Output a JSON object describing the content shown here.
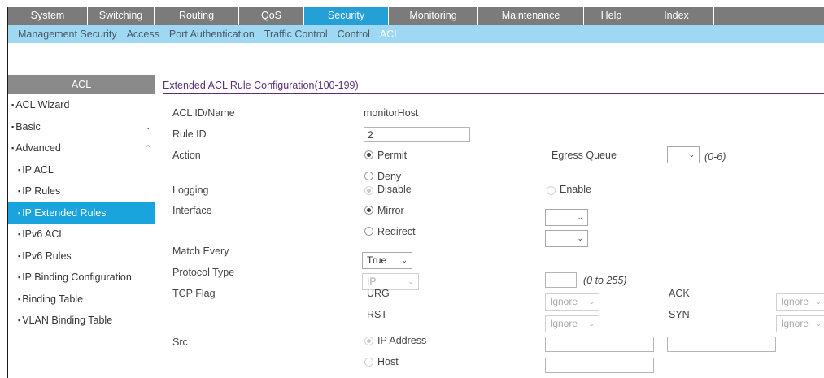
{
  "topnav": [
    {
      "label": "System",
      "w": 98
    },
    {
      "label": "Switching",
      "w": 82
    },
    {
      "label": "Routing",
      "w": 104
    },
    {
      "label": "QoS",
      "w": 80
    },
    {
      "label": "Security",
      "w": 104,
      "active": true
    },
    {
      "label": "Monitoring",
      "w": 110
    },
    {
      "label": "Maintenance",
      "w": 130
    },
    {
      "label": "Help",
      "w": 68
    },
    {
      "label": "Index",
      "w": 92
    }
  ],
  "subnav": [
    {
      "label": "Management Security"
    },
    {
      "label": "Access"
    },
    {
      "label": "Port Authentication"
    },
    {
      "label": "Traffic Control"
    },
    {
      "label": "Control"
    },
    {
      "label": "ACL",
      "active": true
    }
  ],
  "sidebar": {
    "title": "ACL",
    "items": [
      {
        "label": "ACL Wizard",
        "level": 1
      },
      {
        "label": "Basic",
        "level": 1,
        "chevron": "⌄"
      },
      {
        "label": "Advanced",
        "level": 1,
        "chevron": "⌃"
      },
      {
        "label": "IP ACL",
        "level": 2
      },
      {
        "label": "IP Rules",
        "level": 2
      },
      {
        "label": "IP Extended Rules",
        "level": 2,
        "active": true
      },
      {
        "label": "IPv6 ACL",
        "level": 2
      },
      {
        "label": "IPv6 Rules",
        "level": 2
      },
      {
        "label": "IP Binding Configuration",
        "level": 2
      },
      {
        "label": "Binding Table",
        "level": 2
      },
      {
        "label": "VLAN Binding Table",
        "level": 2
      }
    ]
  },
  "form": {
    "title": "Extended ACL Rule Configuration(100-199)",
    "acl_id_label": "ACL ID/Name",
    "acl_id_value": "monitorHost",
    "rule_id_label": "Rule ID",
    "rule_id_value": "2",
    "action_label": "Action",
    "permit_label": "Permit",
    "deny_label": "Deny",
    "egress_queue_label": "Egress Queue",
    "egress_queue_range": "(0-6)",
    "logging_label": "Logging",
    "disable_label": "Disable",
    "enable_label": "Enable",
    "interface_label": "Interface",
    "mirror_label": "Mirror",
    "redirect_label": "Redirect",
    "match_every_label": "Match Every",
    "match_every_value": "True",
    "protocol_type_label": "Protocol Type",
    "protocol_type_value": "IP",
    "protocol_range": "(0 to 255)",
    "tcp_flag_label": "TCP Flag",
    "urg_label": "URG",
    "rst_label": "RST",
    "ack_label": "ACK",
    "syn_label": "SYN",
    "ignore_value": "Ignore",
    "src_label": "Src",
    "ip_address_label": "IP Address",
    "host_label": "Host"
  },
  "icons": {
    "dropdown": "chevron-down-icon",
    "radio": "radio-icon"
  }
}
